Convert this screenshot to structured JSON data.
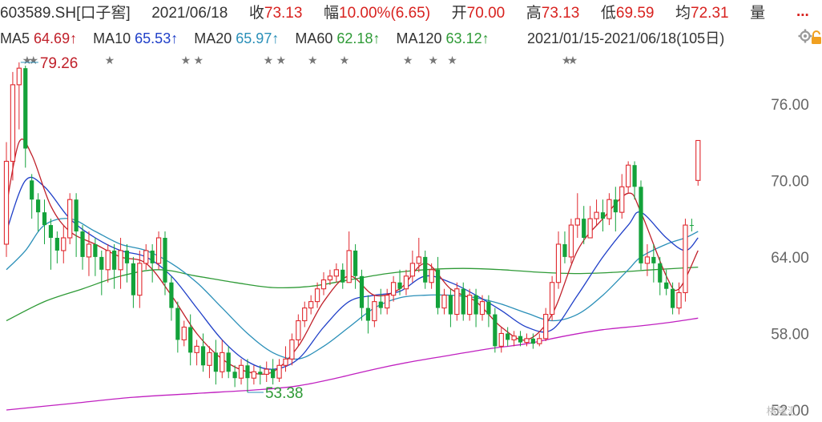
{
  "header": {
    "code": "603589.SH",
    "name": "[口子窖]",
    "date": "2021/06/18",
    "close_label": "收",
    "close": "73.13",
    "change_label": "幅",
    "change": "10.00%(6.65)",
    "open_label": "开",
    "open": "70.00",
    "high_label": "高",
    "high": "73.13",
    "low_label": "低",
    "low": "69.59",
    "avg_label": "均",
    "avg": "72.31",
    "volume_label": "量",
    "more": "..."
  },
  "ma": {
    "ma5_label": "MA5",
    "ma5": "64.69↑",
    "ma10_label": "MA10",
    "ma10": "65.53↑",
    "ma20_label": "MA20",
    "ma20": "65.97↑",
    "ma60_label": "MA60",
    "ma60": "62.18↑",
    "ma120_label": "MA120",
    "ma120": "63.12↑",
    "range": "2021/01/15-2021/06/18(105日)",
    "colors": {
      "ma5": "#c0202a",
      "ma10": "#1f3fc8",
      "ma20": "#2a8fb8",
      "ma60": "#2e9a36",
      "ma120": "#c020c0"
    }
  },
  "icons": [
    "settings-icon",
    "lock-icon"
  ],
  "chart_data": {
    "type": "candlestick",
    "y_ticks": [
      "76.00",
      "70.00",
      "64.00",
      "58.00",
      "52.00"
    ],
    "ylim": [
      51.5,
      79.5
    ],
    "annotations": {
      "high": "79.26",
      "low": "53.38"
    },
    "watermark": "格隆汇",
    "up_color": "#e0282e",
    "down_color": "#13a23a",
    "star_positions": [
      1,
      2,
      14,
      26,
      28,
      39,
      41,
      46,
      51,
      61,
      65,
      68,
      86,
      87
    ],
    "candles": [
      [
        65,
        71.5,
        64,
        73
      ],
      [
        71.5,
        77.5,
        70,
        78.5
      ],
      [
        77.5,
        78.8,
        74,
        79.26
      ],
      [
        78.8,
        72.5,
        71,
        79
      ],
      [
        70,
        68.5,
        67,
        70.5
      ],
      [
        68.5,
        67.5,
        66,
        69
      ],
      [
        67.5,
        66.5,
        65,
        68.5
      ],
      [
        66.5,
        65.5,
        63,
        67
      ],
      [
        65.5,
        64.5,
        63.5,
        66
      ],
      [
        64.5,
        65.5,
        63.5,
        66.5
      ],
      [
        65.5,
        68.5,
        65,
        69
      ],
      [
        68.5,
        66,
        64,
        69
      ],
      [
        66,
        64,
        63,
        66.5
      ],
      [
        64,
        65,
        62.5,
        66
      ],
      [
        65,
        64,
        62.5,
        65.5
      ],
      [
        64,
        63,
        61,
        64.5
      ],
      [
        63,
        64.5,
        62,
        65
      ],
      [
        64.5,
        63,
        61.5,
        65
      ],
      [
        63,
        64.5,
        61.5,
        65.5
      ],
      [
        64.5,
        63.5,
        62,
        65
      ],
      [
        63.5,
        61,
        60,
        64
      ],
      [
        61,
        63.5,
        60,
        64.5
      ],
      [
        63.5,
        64.5,
        63,
        65
      ],
      [
        64.5,
        63.5,
        62,
        65
      ],
      [
        63.5,
        65.5,
        63,
        66
      ],
      [
        65.5,
        62,
        61,
        66
      ],
      [
        62,
        60,
        59,
        62.5
      ],
      [
        60,
        57.5,
        56.5,
        60.5
      ],
      [
        57.5,
        58.5,
        57,
        59
      ],
      [
        58.5,
        56.5,
        55.5,
        59.5
      ],
      [
        56.5,
        57,
        55.5,
        57.5
      ],
      [
        57,
        55.5,
        55,
        58
      ],
      [
        55.5,
        56.5,
        54.5,
        57
      ],
      [
        56.5,
        55,
        54,
        57.5
      ],
      [
        55,
        56.5,
        54.5,
        57.5
      ],
      [
        56.5,
        55,
        54.5,
        57
      ],
      [
        55,
        54.5,
        53.8,
        55.5
      ],
      [
        54.5,
        55.5,
        54,
        56
      ],
      [
        55.5,
        54.5,
        53.38,
        56
      ],
      [
        54.5,
        55,
        54,
        55.5
      ],
      [
        55,
        54.8,
        54,
        55.5
      ],
      [
        54.8,
        55.2,
        54.2,
        55.8
      ],
      [
        55.2,
        54.5,
        54,
        56
      ],
      [
        54.5,
        55.5,
        54.2,
        56
      ],
      [
        55.5,
        56,
        55,
        57
      ],
      [
        56,
        57.5,
        55.5,
        58
      ],
      [
        57.5,
        59,
        57,
        59.5
      ],
      [
        59,
        60,
        58.5,
        60.5
      ],
      [
        60,
        60.5,
        59.5,
        61
      ],
      [
        60.5,
        61.5,
        60,
        62
      ],
      [
        61.5,
        62.2,
        61,
        62.8
      ],
      [
        62.2,
        62.5,
        61.8,
        63
      ],
      [
        62.5,
        63,
        62,
        63.5
      ],
      [
        63,
        62,
        61.5,
        63.5
      ],
      [
        62,
        64.5,
        62,
        66
      ],
      [
        64.5,
        62.5,
        61.5,
        65
      ],
      [
        62.5,
        60,
        59,
        63
      ],
      [
        60,
        59,
        58,
        61
      ],
      [
        59,
        60.5,
        58.5,
        61
      ],
      [
        60.5,
        60,
        59.5,
        61.5
      ],
      [
        60,
        61,
        59.5,
        61.5
      ],
      [
        61,
        62,
        60.5,
        62.5
      ],
      [
        62,
        61.5,
        61,
        63
      ],
      [
        61.5,
        62.5,
        61,
        63
      ],
      [
        62.5,
        63.5,
        62,
        64.5
      ],
      [
        63.5,
        64,
        62.8,
        65.5
      ],
      [
        64,
        62,
        61.5,
        64.5
      ],
      [
        62,
        63,
        61.5,
        63.5
      ],
      [
        63,
        60,
        59.5,
        64
      ],
      [
        60,
        61,
        59.5,
        61.5
      ],
      [
        61,
        59.5,
        58.5,
        61.5
      ],
      [
        59.5,
        61.5,
        59,
        62
      ],
      [
        61.5,
        59.5,
        59,
        62
      ],
      [
        59.5,
        61,
        59,
        61.5
      ],
      [
        61,
        59.5,
        58.5,
        61.5
      ],
      [
        59.5,
        60.5,
        59,
        61
      ],
      [
        60.5,
        59.5,
        58.5,
        61
      ],
      [
        59.5,
        57,
        56.5,
        60
      ],
      [
        57,
        58,
        56.5,
        58.5
      ],
      [
        58,
        57.5,
        57,
        58.5
      ],
      [
        57.5,
        57.8,
        57,
        58.2
      ],
      [
        57.8,
        57.3,
        57,
        58.2
      ],
      [
        57.3,
        57.6,
        57,
        58
      ],
      [
        57.6,
        57.2,
        56.8,
        58
      ],
      [
        57.2,
        57.6,
        57,
        58
      ],
      [
        57.6,
        59.5,
        57.4,
        60
      ],
      [
        59.5,
        62,
        59,
        62.5
      ],
      [
        62,
        65,
        61.5,
        66
      ],
      [
        65,
        64,
        63.5,
        66
      ],
      [
        64,
        66.5,
        63.5,
        67
      ],
      [
        66.5,
        67,
        65.5,
        69
      ],
      [
        67,
        65.5,
        65,
        68
      ],
      [
        65.5,
        67,
        65.5,
        68
      ],
      [
        67,
        67.5,
        66.5,
        68.5
      ],
      [
        67.5,
        67,
        66,
        68.5
      ],
      [
        67,
        68.5,
        66.5,
        69
      ],
      [
        68.5,
        67.5,
        66,
        69.5
      ],
      [
        67.5,
        69.5,
        67,
        70.5
      ],
      [
        69.5,
        71.2,
        69,
        71.5
      ],
      [
        71.2,
        69.5,
        68.5,
        71.5
      ],
      [
        69.5,
        63.5,
        63,
        70
      ],
      [
        63.5,
        64,
        62.5,
        65
      ],
      [
        64,
        63.5,
        62,
        65
      ],
      [
        63.5,
        62,
        61,
        64
      ],
      [
        62,
        61.5,
        61,
        63
      ],
      [
        61.5,
        60,
        59.5,
        62
      ],
      [
        60,
        61.2,
        59.5,
        62
      ],
      [
        61.2,
        66.5,
        60.5,
        67
      ],
      [
        66.5,
        66.48,
        66,
        67
      ],
      [
        70,
        73.13,
        69.59,
        73.13
      ]
    ],
    "ma_lines": {
      "ma5": [
        [
          0,
          68
        ],
        [
          2,
          73
        ],
        [
          4,
          72
        ],
        [
          7,
          68
        ],
        [
          10,
          66
        ],
        [
          14,
          65
        ],
        [
          18,
          64
        ],
        [
          22,
          63.5
        ],
        [
          26,
          61
        ],
        [
          30,
          58
        ],
        [
          34,
          56
        ],
        [
          38,
          55
        ],
        [
          42,
          55
        ],
        [
          46,
          57
        ],
        [
          50,
          60.5
        ],
        [
          54,
          62.5
        ],
        [
          58,
          61
        ],
        [
          62,
          61.5
        ],
        [
          66,
          63.5
        ],
        [
          70,
          61.5
        ],
        [
          74,
          60.5
        ],
        [
          78,
          58.5
        ],
        [
          82,
          57.5
        ],
        [
          86,
          59.5
        ],
        [
          90,
          64.5
        ],
        [
          94,
          67
        ],
        [
          98,
          69
        ],
        [
          100,
          67.5
        ],
        [
          104,
          62.5
        ],
        [
          106,
          61.5
        ],
        [
          109,
          64.5
        ]
      ],
      "ma10": [
        [
          0,
          66
        ],
        [
          3,
          70
        ],
        [
          6,
          69.5
        ],
        [
          10,
          67
        ],
        [
          14,
          65.5
        ],
        [
          18,
          64.5
        ],
        [
          22,
          64
        ],
        [
          26,
          62.5
        ],
        [
          30,
          60
        ],
        [
          34,
          57.5
        ],
        [
          38,
          55.8
        ],
        [
          42,
          55.2
        ],
        [
          46,
          56
        ],
        [
          50,
          58.5
        ],
        [
          54,
          60.5
        ],
        [
          58,
          61
        ],
        [
          62,
          61.3
        ],
        [
          66,
          62.5
        ],
        [
          70,
          62
        ],
        [
          74,
          61
        ],
        [
          78,
          59.8
        ],
        [
          82,
          58.5
        ],
        [
          86,
          58.3
        ],
        [
          90,
          61
        ],
        [
          94,
          64
        ],
        [
          98,
          66.5
        ],
        [
          100,
          67.5
        ],
        [
          104,
          65.5
        ],
        [
          107,
          64.5
        ],
        [
          109,
          65.5
        ]
      ],
      "ma20": [
        [
          0,
          63
        ],
        [
          3,
          64.5
        ],
        [
          6,
          66.5
        ],
        [
          10,
          67
        ],
        [
          14,
          66
        ],
        [
          18,
          65
        ],
        [
          22,
          64.5
        ],
        [
          26,
          63.5
        ],
        [
          30,
          62
        ],
        [
          34,
          60
        ],
        [
          38,
          58
        ],
        [
          42,
          56.5
        ],
        [
          46,
          56
        ],
        [
          50,
          57
        ],
        [
          54,
          58.5
        ],
        [
          58,
          60
        ],
        [
          62,
          60.8
        ],
        [
          66,
          61
        ],
        [
          70,
          61
        ],
        [
          74,
          60.8
        ],
        [
          78,
          60.3
        ],
        [
          82,
          59.6
        ],
        [
          86,
          59
        ],
        [
          90,
          59.5
        ],
        [
          94,
          61
        ],
        [
          98,
          63
        ],
        [
          100,
          64
        ],
        [
          104,
          65
        ],
        [
          107,
          65.5
        ],
        [
          109,
          66
        ]
      ],
      "ma60": [
        [
          0,
          59
        ],
        [
          6,
          60.5
        ],
        [
          12,
          61.5
        ],
        [
          18,
          62.5
        ],
        [
          24,
          63
        ],
        [
          30,
          62.5
        ],
        [
          36,
          62
        ],
        [
          42,
          61.6
        ],
        [
          48,
          61.7
        ],
        [
          54,
          62.2
        ],
        [
          60,
          62.7
        ],
        [
          66,
          63
        ],
        [
          72,
          63.1
        ],
        [
          78,
          63
        ],
        [
          84,
          62.8
        ],
        [
          90,
          62.7
        ],
        [
          96,
          62.8
        ],
        [
          102,
          63
        ],
        [
          109,
          63.2
        ]
      ],
      "ma120": [
        [
          0,
          52
        ],
        [
          10,
          52.5
        ],
        [
          20,
          53
        ],
        [
          30,
          53.3
        ],
        [
          40,
          53.6
        ],
        [
          46,
          53.9
        ],
        [
          52,
          54.5
        ],
        [
          58,
          55.2
        ],
        [
          64,
          55.8
        ],
        [
          70,
          56.3
        ],
        [
          76,
          56.8
        ],
        [
          82,
          57.2
        ],
        [
          88,
          57.8
        ],
        [
          94,
          58.3
        ],
        [
          100,
          58.6
        ],
        [
          105,
          58.9
        ],
        [
          109,
          59.2
        ]
      ]
    }
  }
}
